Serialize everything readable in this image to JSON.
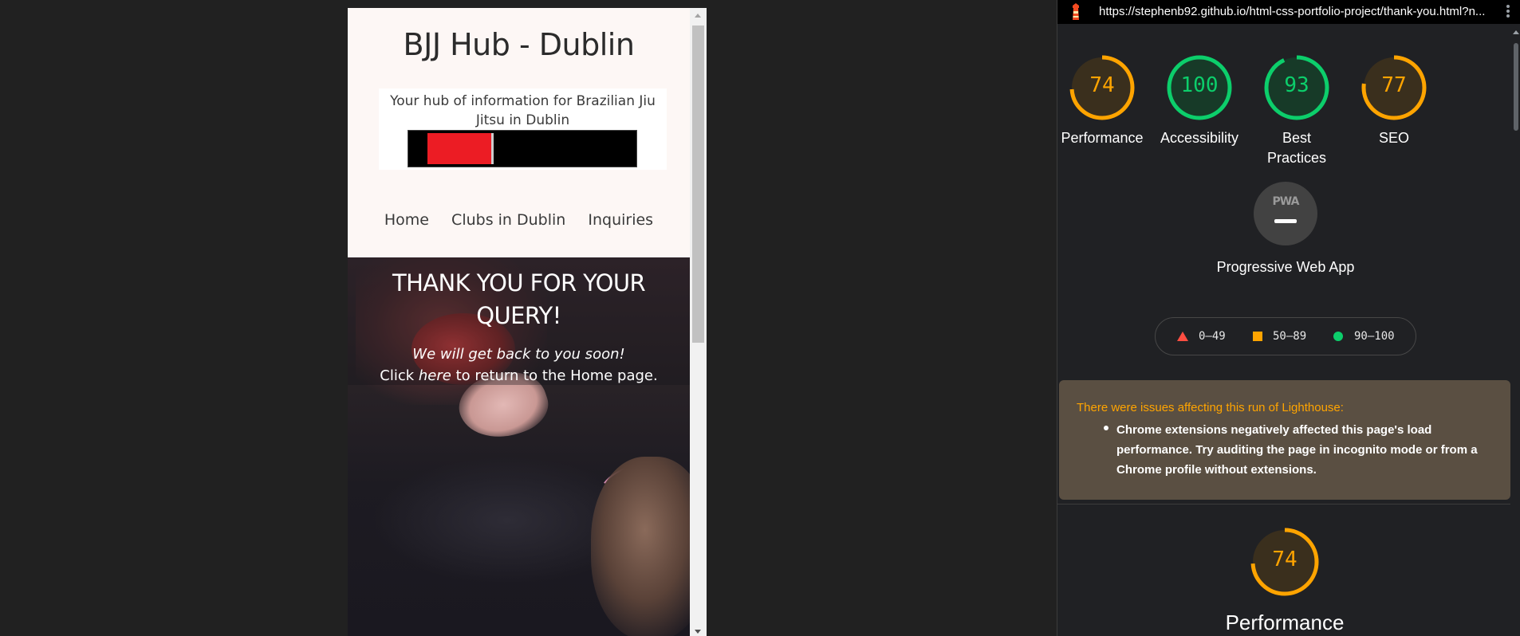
{
  "site": {
    "title": "BJJ Hub - Dublin",
    "tagline": "Your hub of information for Brazilian Jiu Jitsu in Dublin",
    "nav": [
      "Home",
      "Clubs in Dublin",
      "Inquiries"
    ],
    "hero": {
      "heading": "THANK YOU FOR YOUR QUERY!",
      "message": "We will get back to you soon!",
      "return_prefix": "Click ",
      "return_link": "here",
      "return_suffix": " to return to the Home page."
    }
  },
  "lighthouse": {
    "url": "https://stephenb92.github.io/html-css-portfolio-project/thank-you.html?n...",
    "colors": {
      "average": "#ffa400",
      "pass": "#0cce6b",
      "fail": "#ff4e42"
    },
    "scores": [
      {
        "label": "Performance",
        "value": 74,
        "status": "average"
      },
      {
        "label": "Accessibility",
        "value": 100,
        "status": "pass"
      },
      {
        "label": "Best Practices",
        "value": 93,
        "status": "pass"
      },
      {
        "label": "SEO",
        "value": 77,
        "status": "average"
      }
    ],
    "pwa": {
      "badge": "PWA",
      "label": "Progressive Web App"
    },
    "legend": [
      "0–49",
      "50–89",
      "90–100"
    ],
    "warning": {
      "title": "There were issues affecting this run of Lighthouse:",
      "items": [
        "Chrome extensions negatively affected this page's load performance. Try auditing the page in incognito mode or from a Chrome profile without extensions."
      ]
    },
    "detail": {
      "value": 74,
      "status": "average",
      "label": "Performance"
    }
  }
}
